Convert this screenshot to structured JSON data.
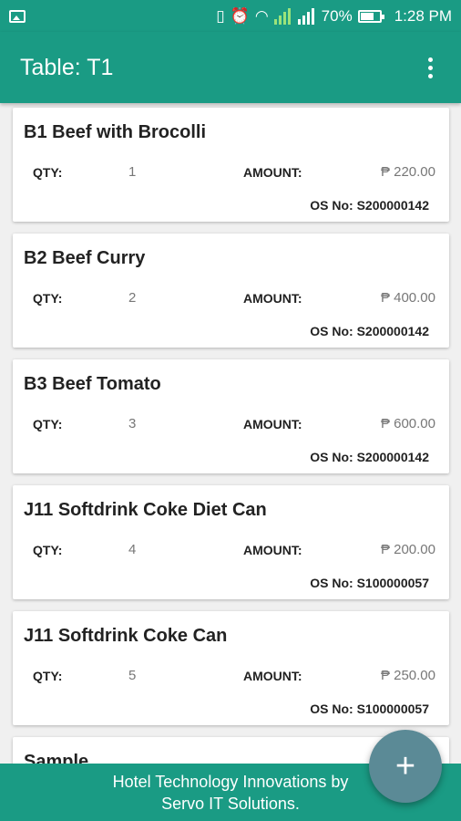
{
  "status_bar": {
    "battery": "70%",
    "time": "1:28 PM",
    "icons": [
      "gallery-icon",
      "vibrate-icon",
      "alarm-icon",
      "wifi-icon",
      "signal-icon",
      "signal-icon",
      "battery-icon"
    ]
  },
  "app_bar": {
    "title": "Table: T1"
  },
  "labels": {
    "qty": "QTY:",
    "amount": "AMOUNT:",
    "os_prefix": "OS No: "
  },
  "items": [
    {
      "name": "B1 Beef with Brocolli",
      "qty": "1",
      "amount": "₱ 220.00",
      "os_no": "S200000142"
    },
    {
      "name": "B2 Beef Curry",
      "qty": "2",
      "amount": "₱ 400.00",
      "os_no": "S200000142"
    },
    {
      "name": "B3 Beef Tomato",
      "qty": "3",
      "amount": "₱ 600.00",
      "os_no": "S200000142"
    },
    {
      "name": "J11 Softdrink Coke Diet Can",
      "qty": "4",
      "amount": "₱ 200.00",
      "os_no": "S100000057"
    },
    {
      "name": "J11 Softdrink Coke Can",
      "qty": "5",
      "amount": "₱ 250.00",
      "os_no": "S100000057"
    },
    {
      "name": "Sample"
    }
  ],
  "footer": {
    "line1": "Hotel Technology Innovations by",
    "line2": "Servo IT Solutions."
  },
  "fab": {
    "symbol": "+"
  },
  "colors": {
    "primary": "#1a9b84",
    "fab": "#5b8a96"
  }
}
